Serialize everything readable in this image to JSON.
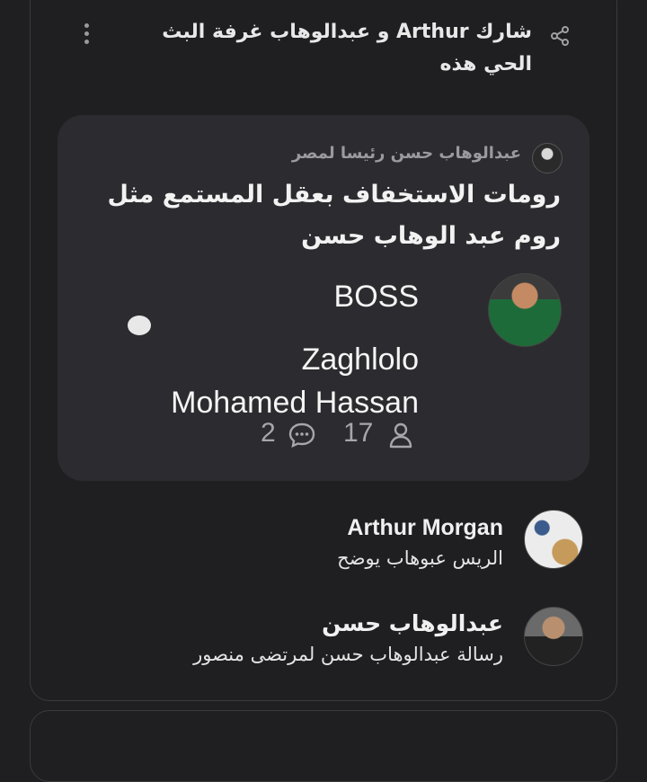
{
  "share": {
    "text": "شارك Arthur و عبدالوهاب غرفة البث الحي هذه"
  },
  "room": {
    "host_name": "عبدالوهاب حسن رئيسا لمصر",
    "title": "رومات الاستخفاف بعقل المستمع مثل روم عبد الوهاب حسن",
    "speaker": {
      "line1": "BOSS",
      "line2": "Zaghlolo",
      "line3": "Mohamed Hassan"
    },
    "stats": {
      "listeners": "17",
      "comments": "2"
    }
  },
  "participants": [
    {
      "name": "Arthur Morgan",
      "message": "الريس عبوهاب يوضح"
    },
    {
      "name": "عبدالوهاب حسن",
      "message": "رسالة عبدالوهاب حسن لمرتضى منصور"
    }
  ],
  "icons": {
    "menu": "more-vertical-icon",
    "share": "share-icon",
    "chat": "chat-bubble-icon",
    "listeners": "person-icon",
    "comments": "comment-icon"
  },
  "colors": {
    "background": "#1f1f21",
    "card_inner": "#2c2c30",
    "muted": "#9b9b9f"
  }
}
